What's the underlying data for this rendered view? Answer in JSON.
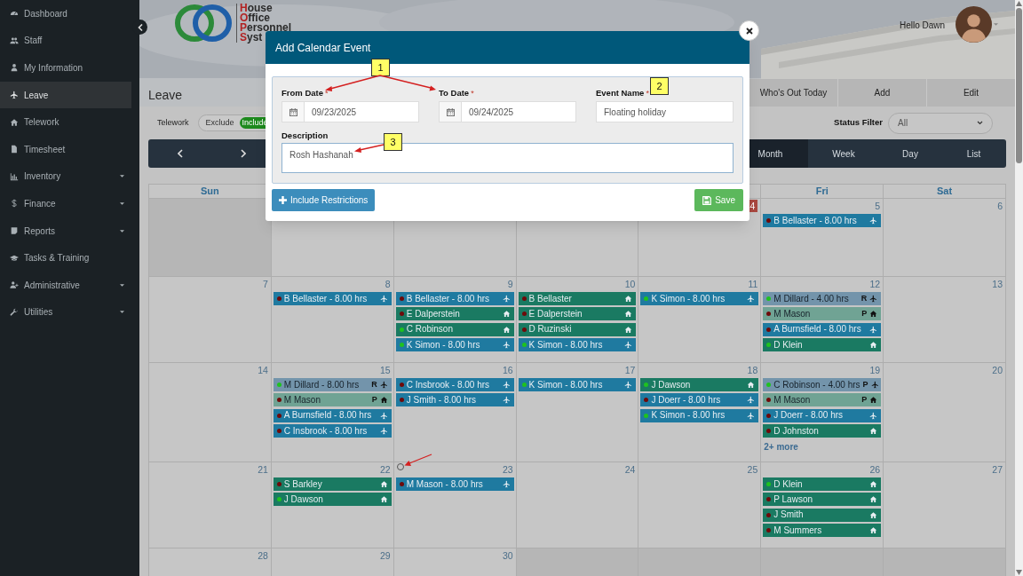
{
  "sidebar": {
    "items": [
      {
        "label": "Dashboard",
        "selected": false,
        "expandable": false
      },
      {
        "label": "Staff",
        "selected": false,
        "expandable": false
      },
      {
        "label": "My Information",
        "selected": false,
        "expandable": false
      },
      {
        "label": "Leave",
        "selected": true,
        "expandable": false
      },
      {
        "label": "Telework",
        "selected": false,
        "expandable": false
      },
      {
        "label": "Timesheet",
        "selected": false,
        "expandable": false
      },
      {
        "label": "Inventory",
        "selected": false,
        "expandable": true
      },
      {
        "label": "Finance",
        "selected": false,
        "expandable": true
      },
      {
        "label": "Reports",
        "selected": false,
        "expandable": true
      },
      {
        "label": "Tasks & Training",
        "selected": false,
        "expandable": false
      },
      {
        "label": "Administrative",
        "selected": false,
        "expandable": true
      },
      {
        "label": "Utilities",
        "selected": false,
        "expandable": true
      }
    ]
  },
  "header": {
    "logo_lines": [
      {
        "initial": "H",
        "rest": "ouse"
      },
      {
        "initial": "O",
        "rest": "ffice"
      },
      {
        "initial": "P",
        "rest": "ersonnel"
      },
      {
        "initial": "S",
        "rest": "yst"
      }
    ],
    "greeting": "Hello Dawn",
    "tabs": [
      {
        "label": "Who's Out Today"
      },
      {
        "label": "Add"
      },
      {
        "label": "Edit"
      }
    ],
    "page_title": "Leave"
  },
  "toolbar": {
    "telework_label": "Telework",
    "toggle": [
      {
        "label": "Exclude",
        "selected": false
      },
      {
        "label": "Include",
        "selected": true
      }
    ],
    "status_filter": {
      "label": "Status Filter",
      "value": "All"
    }
  },
  "calendar": {
    "views": [
      {
        "label": "Month",
        "selected": true
      },
      {
        "label": "Week",
        "selected": false
      },
      {
        "label": "Day",
        "selected": false
      },
      {
        "label": "List",
        "selected": false
      }
    ],
    "weekday_headers": {
      "sun": "Sun",
      "fri": "Fri",
      "sat": "Sat"
    },
    "weeks": [
      {
        "days": [
          {
            "outside_month": true
          },
          {
            "outside_month": false
          },
          {
            "outside_month": false
          },
          {
            "outside_month": false
          },
          {
            "day": "4",
            "outside_month": false,
            "today": true
          },
          {
            "day": "5",
            "outside_month": false,
            "today": false,
            "events": [
              {
                "text": "B Bellaster - 8.00 hrs",
                "kind": "leave",
                "pending": false,
                "color": "#6e0a0a"
              }
            ]
          },
          {
            "day": "6",
            "outside_month": false,
            "today": false
          }
        ]
      },
      {
        "days": [
          {
            "day": "7",
            "outside_month": false,
            "today": false
          },
          {
            "day": "8",
            "outside_month": false,
            "today": false,
            "events": [
              {
                "text": "B Bellaster - 8.00 hrs",
                "kind": "leave",
                "pending": false,
                "color": "#6e0a0a"
              }
            ]
          },
          {
            "day": "9",
            "outside_month": false,
            "today": false,
            "events": [
              {
                "text": "B Bellaster - 8.00 hrs",
                "kind": "leave",
                "pending": false,
                "color": "#6e0a0a"
              },
              {
                "text": "E Dalperstein",
                "kind": "telework",
                "pending": false,
                "color": "#6e0a0a"
              },
              {
                "text": "C Robinson",
                "kind": "telework",
                "pending": false,
                "color": "#1fc21f"
              },
              {
                "text": "K Simon - 8.00 hrs",
                "kind": "leave",
                "pending": false,
                "color": "#1fc21f"
              }
            ]
          },
          {
            "day": "10",
            "outside_month": false,
            "today": false,
            "events": [
              {
                "text": "B Bellaster",
                "kind": "telework",
                "pending": false,
                "color": "#6e0a0a"
              },
              {
                "text": "E Dalperstein",
                "kind": "telework",
                "pending": false,
                "color": "#6e0a0a"
              },
              {
                "text": "D Ruzinski",
                "kind": "telework",
                "pending": false,
                "color": "#6e0a0a"
              },
              {
                "text": "K Simon - 8.00 hrs",
                "kind": "leave",
                "pending": false,
                "color": "#1fc21f"
              }
            ]
          },
          {
            "day": "11",
            "outside_month": false,
            "today": false,
            "events": [
              {
                "text": "K Simon - 8.00 hrs",
                "kind": "leave",
                "pending": false,
                "color": "#1fc21f"
              }
            ]
          },
          {
            "day": "12",
            "outside_month": false,
            "today": false,
            "events": [
              {
                "text": "M Dillard - 4.00 hrs",
                "kind": "leave",
                "pending": true,
                "flag": "R",
                "color": "#1fc21f"
              },
              {
                "text": "M Mason",
                "kind": "telework",
                "pending": true,
                "flag": "P",
                "color": "#6e0a0a"
              },
              {
                "text": "A Burnsfield - 8.00 hrs",
                "kind": "leave",
                "pending": false,
                "color": "#6e0a0a"
              },
              {
                "text": "D Klein",
                "kind": "telework",
                "pending": false,
                "color": "#1fc21f"
              }
            ]
          },
          {
            "day": "13",
            "outside_month": false,
            "today": false
          }
        ]
      },
      {
        "days": [
          {
            "day": "14",
            "outside_month": false,
            "today": false
          },
          {
            "day": "15",
            "outside_month": false,
            "today": false,
            "events": [
              {
                "text": "M Dillard - 8.00 hrs",
                "kind": "leave",
                "pending": true,
                "flag": "R",
                "color": "#1fc21f"
              },
              {
                "text": "M Mason",
                "kind": "telework",
                "pending": true,
                "flag": "P",
                "color": "#6e0a0a"
              },
              {
                "text": "A Burnsfield - 8.00 hrs",
                "kind": "leave",
                "pending": false,
                "color": "#6e0a0a"
              },
              {
                "text": "C Insbrook - 8.00 hrs",
                "kind": "leave",
                "pending": false,
                "color": "#6e0a0a"
              }
            ]
          },
          {
            "day": "16",
            "outside_month": false,
            "today": false,
            "events": [
              {
                "text": "C Insbrook - 8.00 hrs",
                "kind": "leave",
                "pending": false,
                "color": "#6e0a0a"
              },
              {
                "text": "J Smith - 8.00 hrs",
                "kind": "leave",
                "pending": false,
                "color": "#6e0a0a"
              }
            ]
          },
          {
            "day": "17",
            "outside_month": false,
            "today": false,
            "events": [
              {
                "text": "K Simon - 8.00 hrs",
                "kind": "leave",
                "pending": false,
                "color": "#1fc21f"
              }
            ]
          },
          {
            "day": "18",
            "outside_month": false,
            "today": false,
            "events": [
              {
                "text": "J Dawson",
                "kind": "telework",
                "pending": false,
                "color": "#1fc21f"
              },
              {
                "text": "J Doerr - 8.00 hrs",
                "kind": "leave",
                "pending": false,
                "color": "#6e0a0a"
              },
              {
                "text": "K Simon - 8.00 hrs",
                "kind": "leave",
                "pending": false,
                "color": "#1fc21f"
              }
            ]
          },
          {
            "day": "19",
            "outside_month": false,
            "today": false,
            "events": [
              {
                "text": "C Robinson - 4.00 hrs",
                "kind": "leave",
                "pending": true,
                "flag": "P",
                "color": "#1fc21f"
              },
              {
                "text": "M Mason",
                "kind": "telework",
                "pending": true,
                "flag": "P",
                "color": "#6e0a0a"
              },
              {
                "text": "J Doerr - 8.00 hrs",
                "kind": "leave",
                "pending": false,
                "color": "#6e0a0a"
              },
              {
                "text": "D Johnston",
                "kind": "telework",
                "pending": false,
                "color": "#6e0a0a"
              }
            ],
            "more": "2+ more"
          },
          {
            "day": "20",
            "outside_month": false,
            "today": false
          }
        ]
      },
      {
        "days": [
          {
            "day": "21",
            "outside_month": false,
            "today": false
          },
          {
            "day": "22",
            "outside_month": false,
            "today": false,
            "events": [
              {
                "text": "S Barkley",
                "kind": "telework",
                "pending": false,
                "color": "#6e0a0a"
              },
              {
                "text": "J Dawson",
                "kind": "telework",
                "pending": false,
                "color": "#1fc21f"
              }
            ]
          },
          {
            "day": "23",
            "outside_month": false,
            "today": false,
            "events": [
              {
                "text": "M Mason - 8.00 hrs",
                "kind": "leave",
                "pending": false,
                "color": "#6e0a0a"
              }
            ]
          },
          {
            "day": "24",
            "outside_month": false,
            "today": false
          },
          {
            "day": "25",
            "outside_month": false,
            "today": false
          },
          {
            "day": "26",
            "outside_month": false,
            "today": false,
            "events": [
              {
                "text": "D Klein",
                "kind": "telework",
                "pending": false,
                "color": "#1fc21f"
              },
              {
                "text": "P Lawson",
                "kind": "telework",
                "pending": false,
                "color": "#6e0a0a"
              },
              {
                "text": "J Smith",
                "kind": "telework",
                "pending": false,
                "color": "#6e0a0a"
              },
              {
                "text": "M Summers",
                "kind": "telework",
                "pending": false,
                "color": "#6e0a0a"
              }
            ]
          },
          {
            "day": "27",
            "outside_month": false,
            "today": false
          }
        ]
      },
      {
        "days": [
          {
            "day": "28",
            "outside_month": false,
            "today": false
          },
          {
            "day": "29",
            "outside_month": false,
            "today": false
          },
          {
            "day": "30",
            "outside_month": false,
            "today": false
          },
          {
            "outside_month": true
          },
          {
            "outside_month": true
          },
          {
            "outside_month": true
          },
          {
            "outside_month": true
          }
        ]
      }
    ]
  },
  "modal": {
    "title": "Add Calendar Event",
    "fields": [
      {
        "label": "From Date",
        "required_mark": "*",
        "value": "09/23/2025",
        "kind": "date"
      },
      {
        "label": "To Date",
        "required_mark": "*",
        "value": "09/24/2025",
        "kind": "date"
      },
      {
        "label": "Event Name",
        "required_mark": "*",
        "value": "Floating holiday",
        "kind": "text"
      }
    ],
    "description": {
      "label": "Description",
      "value": "Rosh Hashanah"
    },
    "buttons": [
      {
        "label": "Include Restrictions",
        "kind": "add"
      },
      {
        "label": "Save",
        "kind": "save"
      }
    ]
  },
  "annotations": [
    {
      "label": "1"
    },
    {
      "label": "2"
    },
    {
      "label": "3"
    }
  ]
}
